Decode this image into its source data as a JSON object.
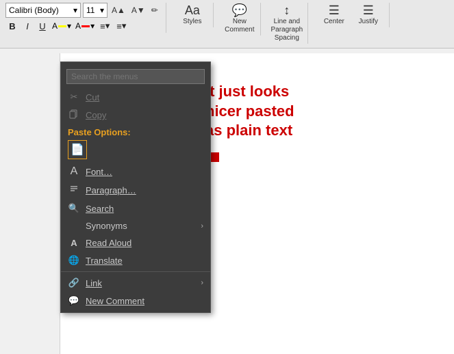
{
  "ribbon": {
    "font": {
      "name": "Calibri (Body)",
      "size": "11",
      "grow_label": "A",
      "shrink_label": "A",
      "clear_label": "🖊"
    },
    "format": {
      "bold": "B",
      "italic": "I",
      "underline": "U",
      "highlight_label": "ab",
      "color_label": "A",
      "bullets_label": "≡",
      "numbering_label": "≡"
    },
    "styles_label": "Styles",
    "new_comment_label": "New\nComment",
    "line_spacing_label": "Line and\nParagraph Spacing",
    "center_label": "Center",
    "justify_label": "Justify"
  },
  "context_menu": {
    "search_placeholder": "Search the menus",
    "items": [
      {
        "id": "cut",
        "icon": "✂",
        "label": "Cut",
        "disabled": true,
        "underlined": true
      },
      {
        "id": "copy",
        "icon": "📋",
        "label": "Copy",
        "disabled": true,
        "underlined": true
      },
      {
        "id": "paste-options",
        "label": "Paste Options:",
        "type": "paste-options"
      },
      {
        "id": "font",
        "icon": "A",
        "label": "Font…",
        "underlined": true
      },
      {
        "id": "paragraph",
        "icon": "≡",
        "label": "Paragraph…",
        "underlined": true
      },
      {
        "id": "search",
        "icon": "🔍",
        "label": "Search",
        "underlined": true
      },
      {
        "id": "synonyms",
        "icon": "",
        "label": "Synonyms",
        "arrow": true
      },
      {
        "id": "read-aloud",
        "icon": "A",
        "label": "Read Aloud",
        "underlined": true
      },
      {
        "id": "translate",
        "icon": "🌐",
        "label": "Translate",
        "underlined": true
      },
      {
        "id": "separator"
      },
      {
        "id": "link",
        "icon": "🔗",
        "label": "Link",
        "arrow": true,
        "underlined": true
      },
      {
        "id": "new-comment",
        "icon": "💬",
        "label": "New Comment",
        "underlined": true
      }
    ]
  },
  "annotation": {
    "text": "It just looks\nnicer pasted\nas plain text"
  },
  "colors": {
    "highlight": "#ffff00",
    "font_color": "#ff0000",
    "accent": "#cc0000"
  }
}
